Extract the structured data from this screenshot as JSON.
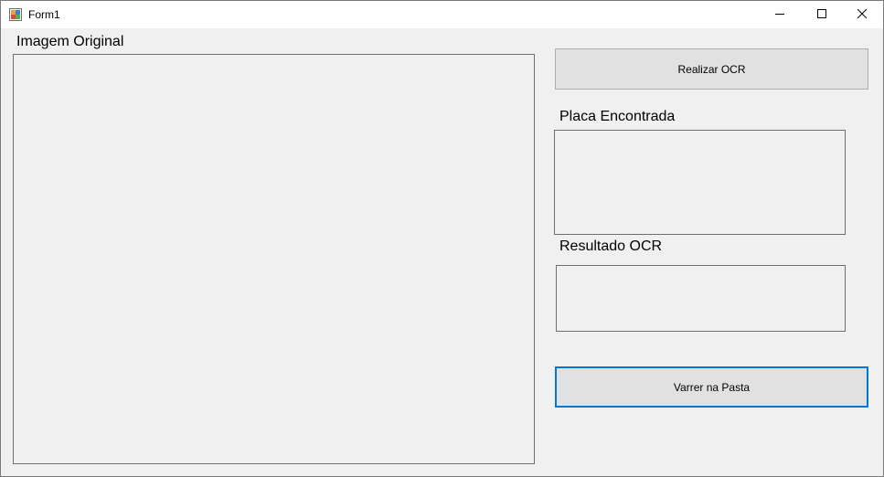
{
  "window": {
    "title": "Form1",
    "icon": "winforms-app-icon",
    "controls": {
      "minimize_icon": "minimize-icon",
      "maximize_icon": "maximize-icon",
      "close_icon": "close-icon"
    }
  },
  "main": {
    "original_image_label": "Imagem Original",
    "plate_found_label": "Placa Encontrada",
    "ocr_result_label": "Resultado OCR",
    "run_ocr_button": "Realizar OCR",
    "scan_folder_button": "Varrer na Pasta"
  },
  "colors": {
    "form_background": "#f0f0f0",
    "button_background": "#e1e1e1",
    "focus_border": "#0078d7"
  }
}
